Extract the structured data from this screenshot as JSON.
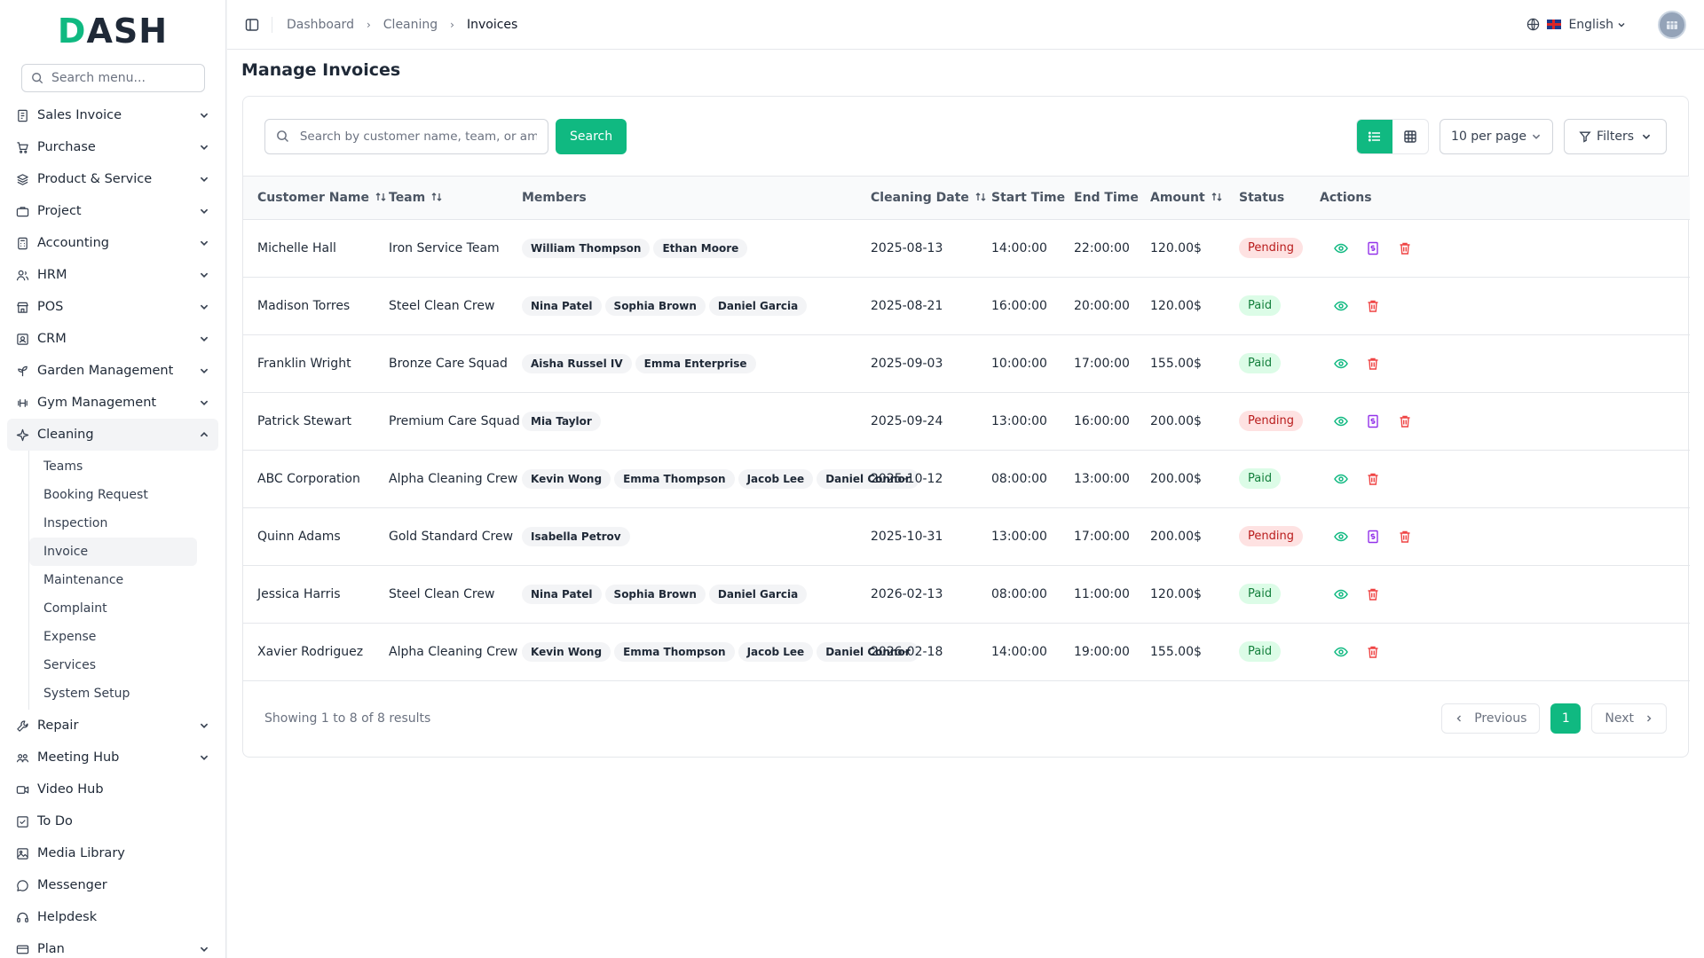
{
  "brand": {
    "logo_text": "DASH",
    "accent": "#10b981"
  },
  "sidebar": {
    "search_placeholder": "Search menu...",
    "items": [
      {
        "label": "Sales Invoice",
        "icon": "invoice-icon"
      },
      {
        "label": "Purchase",
        "icon": "cart-icon"
      },
      {
        "label": "Product & Service",
        "icon": "layers-icon"
      },
      {
        "label": "Project",
        "icon": "briefcase-icon"
      },
      {
        "label": "Accounting",
        "icon": "calculator-icon"
      },
      {
        "label": "HRM",
        "icon": "users-icon"
      },
      {
        "label": "POS",
        "icon": "store-icon"
      },
      {
        "label": "CRM",
        "icon": "contact-icon"
      },
      {
        "label": "Garden Management",
        "icon": "sprout-icon"
      },
      {
        "label": "Gym Management",
        "icon": "dumbbell-icon"
      },
      {
        "label": "Cleaning",
        "icon": "sparkle-icon"
      },
      {
        "label": "Repair",
        "icon": "wrench-icon"
      },
      {
        "label": "Meeting Hub",
        "icon": "meeting-icon"
      },
      {
        "label": "Video Hub",
        "icon": "video-icon"
      },
      {
        "label": "To Do",
        "icon": "checkbox-icon"
      },
      {
        "label": "Media Library",
        "icon": "image-icon"
      },
      {
        "label": "Messenger",
        "icon": "message-icon"
      },
      {
        "label": "Helpdesk",
        "icon": "headset-icon"
      },
      {
        "label": "Plan",
        "icon": "card-icon"
      }
    ],
    "cleaning_sub": [
      "Teams",
      "Booking Request",
      "Inspection",
      "Invoice",
      "Maintenance",
      "Complaint",
      "Expense",
      "Services",
      "System Setup"
    ]
  },
  "topbar": {
    "breadcrumb": [
      "Dashboard",
      "Cleaning",
      "Invoices"
    ],
    "language": "English"
  },
  "page": {
    "title": "Manage Invoices",
    "search_placeholder": "Search by customer name, team, or amount...",
    "search_button": "Search",
    "per_page": "10 per page",
    "filters": "Filters"
  },
  "table": {
    "headers": [
      "Customer Name",
      "Team",
      "Members",
      "Cleaning Date",
      "Start Time",
      "End Time",
      "Amount",
      "Status",
      "Actions"
    ],
    "rows": [
      {
        "customer": "Michelle Hall",
        "team": "Iron Service Team",
        "members": [
          "William Thompson",
          "Ethan Moore"
        ],
        "date": "2025-08-13",
        "start": "14:00:00",
        "end": "22:00:00",
        "amount": "120.00$",
        "status": "Pending"
      },
      {
        "customer": "Madison Torres",
        "team": "Steel Clean Crew",
        "members": [
          "Nina Patel",
          "Sophia Brown",
          "Daniel Garcia"
        ],
        "date": "2025-08-21",
        "start": "16:00:00",
        "end": "20:00:00",
        "amount": "120.00$",
        "status": "Paid"
      },
      {
        "customer": "Franklin Wright",
        "team": "Bronze Care Squad",
        "members": [
          "Aisha Russel IV",
          "Emma Enterprise"
        ],
        "date": "2025-09-03",
        "start": "10:00:00",
        "end": "17:00:00",
        "amount": "155.00$",
        "status": "Paid"
      },
      {
        "customer": "Patrick Stewart",
        "team": "Premium Care Squad",
        "members": [
          "Mia Taylor"
        ],
        "date": "2025-09-24",
        "start": "13:00:00",
        "end": "16:00:00",
        "amount": "200.00$",
        "status": "Pending"
      },
      {
        "customer": "ABC Corporation",
        "team": "Alpha Cleaning Crew",
        "members": [
          "Kevin Wong",
          "Emma Thompson",
          "Jacob Lee",
          "Daniel Connor"
        ],
        "date": "2025-10-12",
        "start": "08:00:00",
        "end": "13:00:00",
        "amount": "200.00$",
        "status": "Paid"
      },
      {
        "customer": "Quinn Adams",
        "team": "Gold Standard Crew",
        "members": [
          "Isabella Petrov"
        ],
        "date": "2025-10-31",
        "start": "13:00:00",
        "end": "17:00:00",
        "amount": "200.00$",
        "status": "Pending"
      },
      {
        "customer": "Jessica Harris",
        "team": "Steel Clean Crew",
        "members": [
          "Nina Patel",
          "Sophia Brown",
          "Daniel Garcia"
        ],
        "date": "2026-02-13",
        "start": "08:00:00",
        "end": "11:00:00",
        "amount": "120.00$",
        "status": "Paid"
      },
      {
        "customer": "Xavier Rodriguez",
        "team": "Alpha Cleaning Crew",
        "members": [
          "Kevin Wong",
          "Emma Thompson",
          "Jacob Lee",
          "Daniel Connor"
        ],
        "date": "2026-02-18",
        "start": "14:00:00",
        "end": "19:00:00",
        "amount": "155.00$",
        "status": "Paid"
      }
    ]
  },
  "pagination": {
    "info": "Showing 1 to 8 of 8 results",
    "previous": "Previous",
    "next": "Next",
    "current": "1"
  }
}
